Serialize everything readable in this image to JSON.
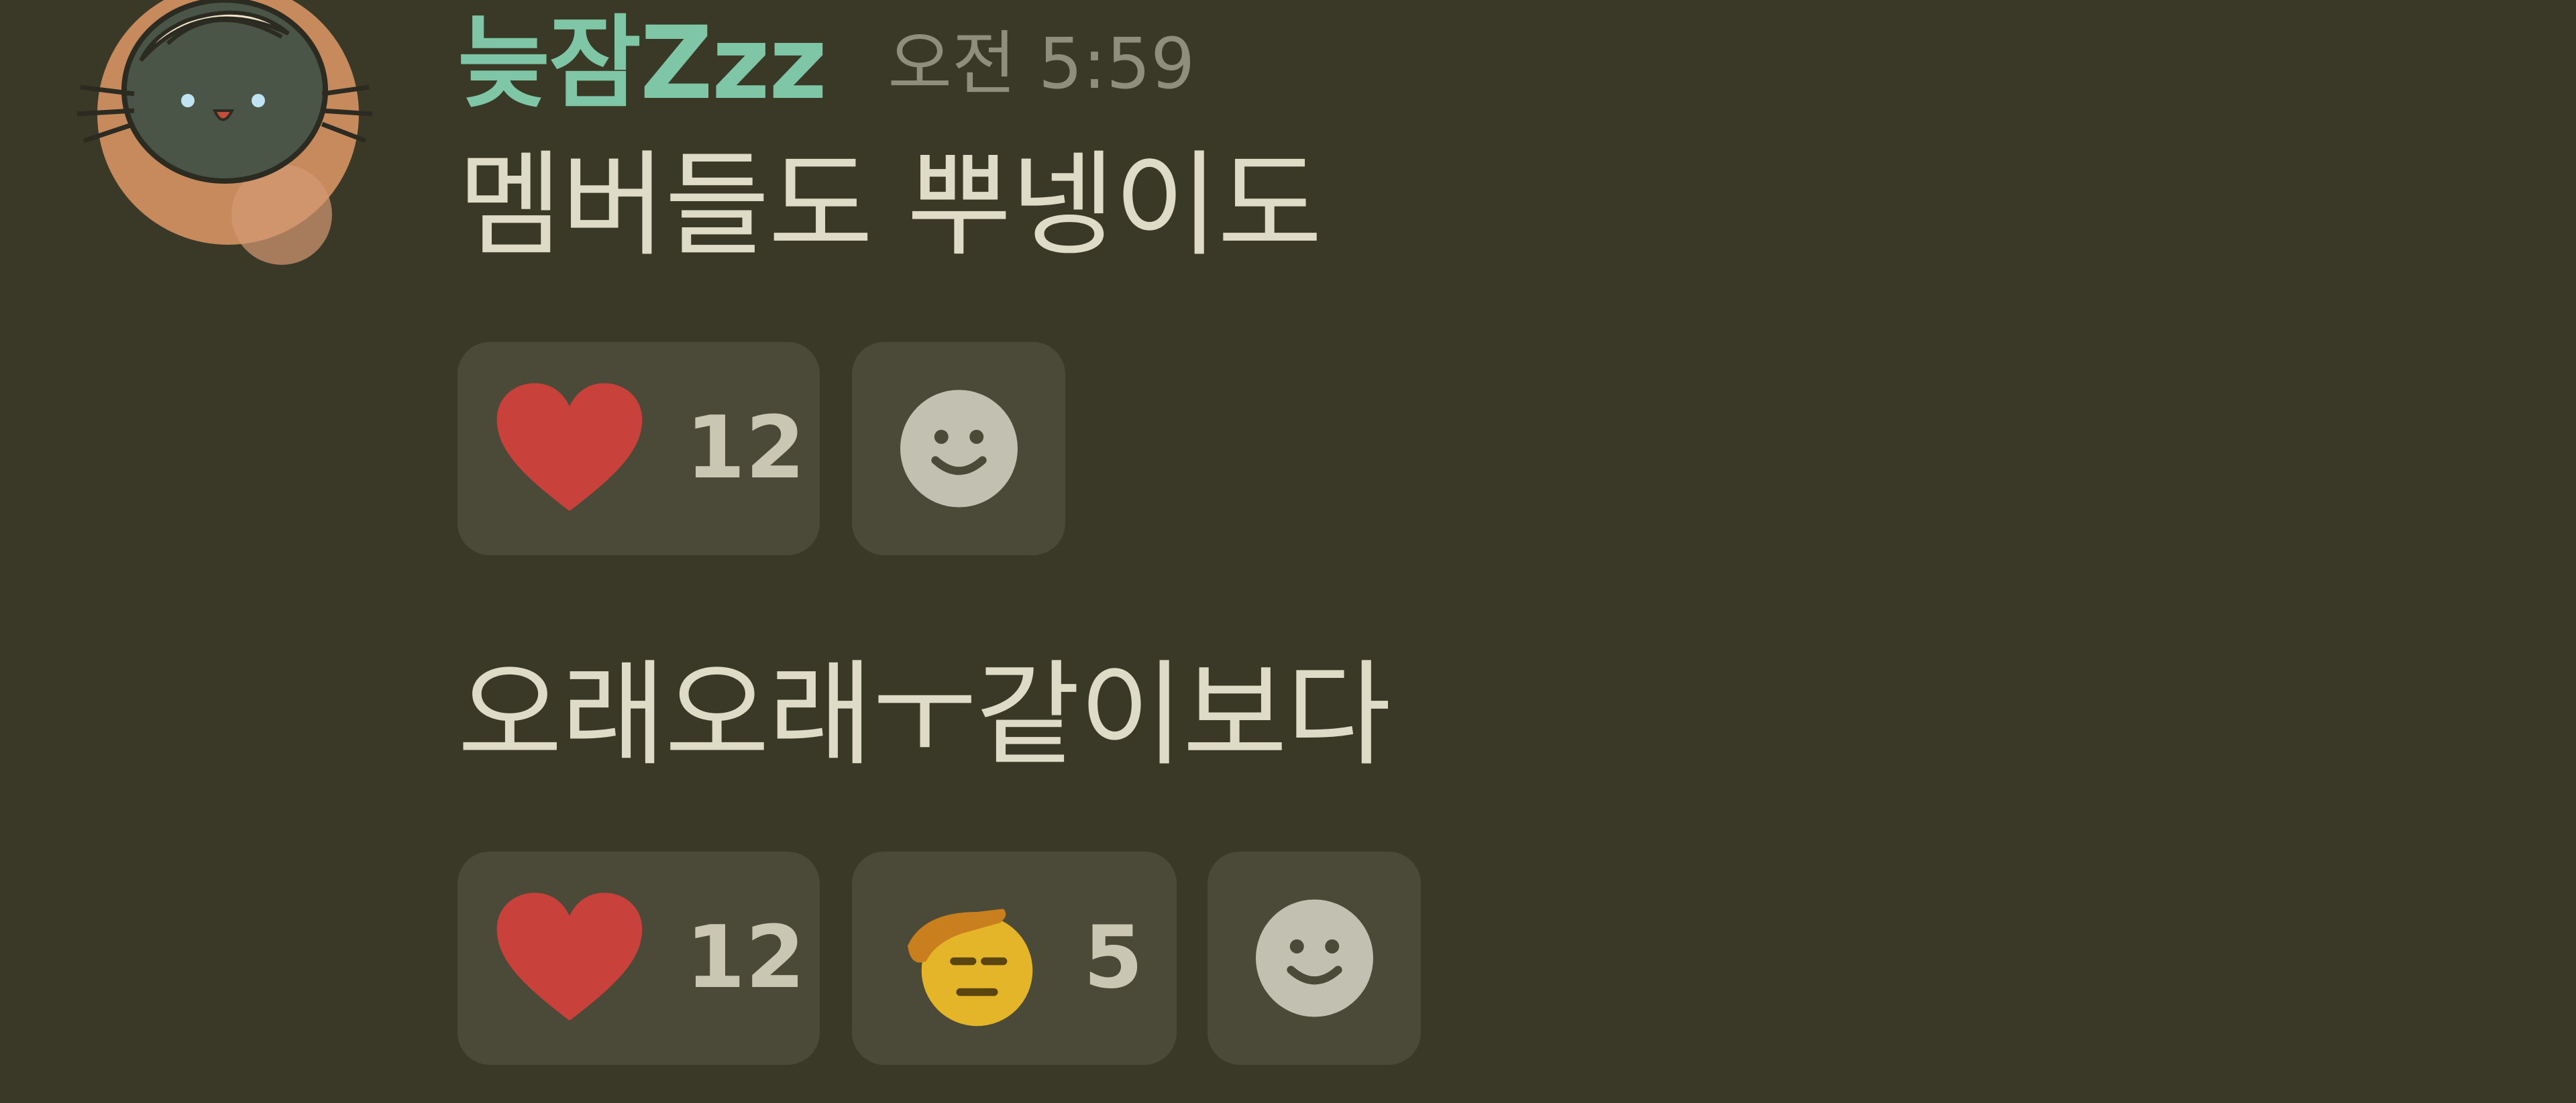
{
  "colors": {
    "background": "#3a3827",
    "username": "#7fc6a6",
    "timestamp": "#8f8d7c",
    "message_text": "#dedbc6",
    "reaction_bg": "#4b4938",
    "heart": "#c9413b",
    "add_reaction_icon": "#c2c0b0"
  },
  "message": {
    "username": "늦잠Zzz",
    "timestamp": "오전 5:59",
    "items": [
      {
        "text": "멤버들도 뿌넹이도",
        "reactions": [
          {
            "icon": "heart-icon",
            "count": "12"
          },
          {
            "icon": "add-reaction-smiley-icon"
          }
        ]
      },
      {
        "text": "오래오래ㅜ같이보다",
        "reactions": [
          {
            "icon": "heart-icon",
            "count": "12"
          },
          {
            "icon": "saluting-face-icon",
            "count": "5"
          },
          {
            "icon": "add-reaction-smiley-icon"
          }
        ]
      }
    ]
  }
}
